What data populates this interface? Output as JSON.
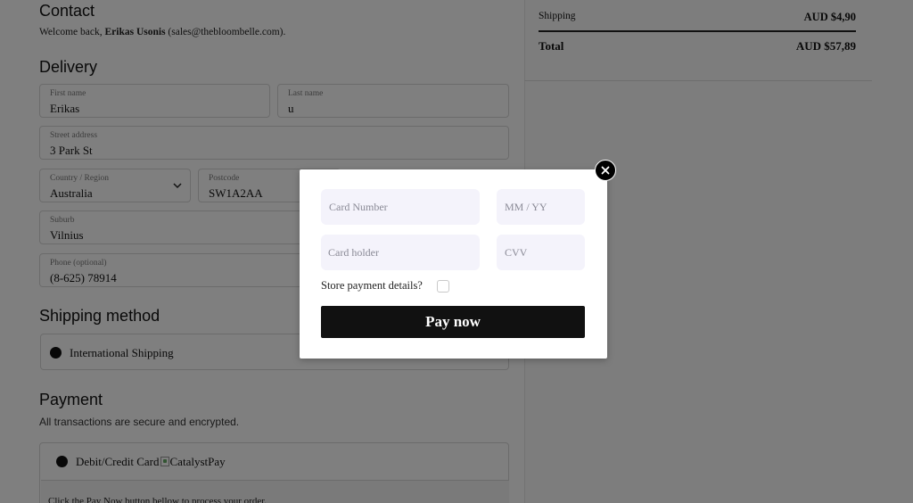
{
  "contact": {
    "title": "Contact",
    "welcome_prefix": "Welcome back, ",
    "user_name": "Erikas Usonis",
    "user_email": " (sales@thebloombelle.com)."
  },
  "delivery": {
    "title": "Delivery",
    "first_name": {
      "label": "First name",
      "value": "Erikas"
    },
    "last_name": {
      "label": "Last name",
      "value": "u"
    },
    "street": {
      "label": "Street address",
      "value": "3 Park St"
    },
    "country": {
      "label": "Country / Region",
      "value": "Australia"
    },
    "postcode": {
      "label": "Postcode",
      "value": "SW1A2AA"
    },
    "suburb": {
      "label": "Suburb",
      "value": "Vilnius"
    },
    "phone": {
      "label": "Phone (optional)",
      "value": "(8-625) 78914"
    }
  },
  "shipping_method": {
    "title": "Shipping method",
    "option": "International Shipping"
  },
  "payment": {
    "title": "Payment",
    "secure_note": "All transactions are secure and encrypted.",
    "option_label": "Debit/Credit Card",
    "option_provider": "CatalystPay",
    "info_text": "Click the Pay Now button bellow to process your order."
  },
  "summary": {
    "shipping_label": "Shipping",
    "shipping_value": "AUD $4,90",
    "total_label": "Total",
    "total_value": "AUD $57,89"
  },
  "modal": {
    "card_number_placeholder": "Card Number",
    "expiry_placeholder": "MM / YY",
    "card_holder_placeholder": "Card holder",
    "cvv_placeholder": "CVV",
    "store_label": "Store payment details?",
    "pay_button": "Pay now",
    "close_symbol": "✕"
  },
  "icons": {
    "close": "close-icon",
    "country_dropdown": "chevron-down-icon",
    "provider_logo": "broken-image-icon"
  }
}
